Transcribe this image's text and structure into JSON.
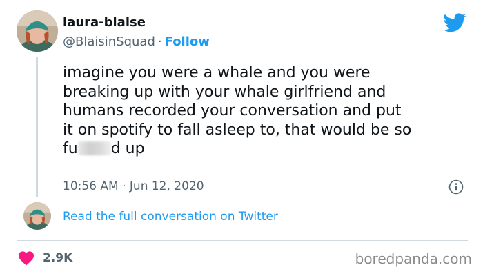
{
  "user": {
    "display_name": "laura-blaise",
    "handle": "@BlaisinSquad",
    "separator": "·",
    "follow_label": "Follow"
  },
  "tweet": {
    "lines": [
      "imagine you were a whale and you were",
      "breaking up with your whale girlfriend and",
      "humans recorded your conversation and put",
      "it on spotify to fall asleep to, that would be so"
    ],
    "last_line_start": "fu",
    "last_line_end": "d up",
    "timestamp": "10:56 AM · Jun 12, 2020"
  },
  "footer": {
    "read_link": "Read the full conversation on Twitter",
    "likes": "2.9K"
  },
  "watermark": "boredpanda.com",
  "colors": {
    "accent": "#1d9bf0",
    "heart": "#f91880",
    "muted_text": "#536471",
    "divider": "#cfd9de"
  },
  "icons": [
    "twitter-bird-icon",
    "info-icon",
    "heart-icon"
  ]
}
